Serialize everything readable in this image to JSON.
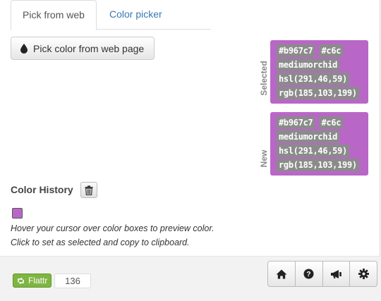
{
  "tabs": [
    {
      "label": "Pick from web",
      "active": true
    },
    {
      "label": "Color picker",
      "active": false
    }
  ],
  "pick_button": {
    "label": "Pick color from web page",
    "icon": "droplet-icon"
  },
  "selected": {
    "label": "Selected",
    "color": "#b967c7",
    "hex": "#b967c7",
    "short_hex": "#c6c",
    "name": "mediumorchid",
    "hsl": "hsl(291,46,59)",
    "rgb": "rgb(185,103,199)"
  },
  "new": {
    "label": "New",
    "color": "#b967c7",
    "hex": "#b967c7",
    "short_hex": "#c6c",
    "name": "mediumorchid",
    "hsl": "hsl(291,46,59)",
    "rgb": "rgb(185,103,199)"
  },
  "history": {
    "title": "Color History",
    "clear_icon": "trash-icon",
    "swatches": [
      "#b967c7"
    ],
    "hint_line1": "Hover your cursor over color boxes to preview color.",
    "hint_line2": "Click to set as selected and copy to clipboard."
  },
  "footer": {
    "flattr_label": "Flattr",
    "flattr_count": "136",
    "toolbar_icons": [
      "home-icon",
      "help-icon",
      "megaphone-icon",
      "gear-icon"
    ]
  }
}
